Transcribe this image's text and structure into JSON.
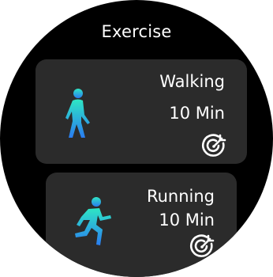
{
  "header": {
    "title": "Exercise"
  },
  "cards": [
    {
      "name": "Walking",
      "duration": "10 Min",
      "icon": "walking-icon",
      "goal_icon": "target-icon"
    },
    {
      "name": "Running",
      "duration": "10 Min",
      "icon": "running-icon",
      "goal_icon": "target-icon"
    }
  ],
  "colors": {
    "background": "#000000",
    "card": "#2b2b2b",
    "text": "#ffffff",
    "icon_gradient_start": "#2ee6c4",
    "icon_gradient_end": "#2a7cf0"
  }
}
